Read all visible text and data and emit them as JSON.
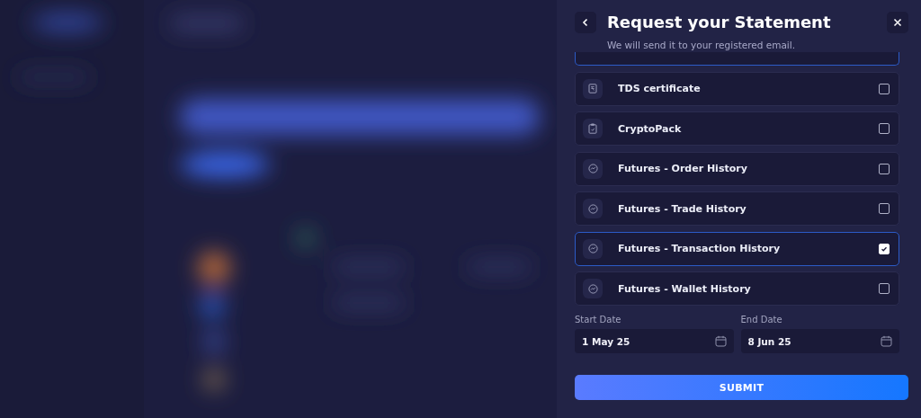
{
  "drawer": {
    "title": "Request your Statement",
    "subtitle": "We will send it to your registered email.",
    "partial_item": {
      "selected": true
    },
    "items": [
      {
        "kind": "document",
        "label": "TDS certificate",
        "checked": false,
        "selected": false
      },
      {
        "kind": "clipboard",
        "label": "CryptoPack",
        "checked": false,
        "selected": false
      },
      {
        "kind": "futures",
        "label": "Futures - Order History",
        "checked": false,
        "selected": false
      },
      {
        "kind": "futures",
        "label": "Futures - Trade History",
        "checked": false,
        "selected": false
      },
      {
        "kind": "futures",
        "label": "Futures - Transaction History",
        "checked": true,
        "selected": true
      },
      {
        "kind": "futures",
        "label": "Futures - Wallet History",
        "checked": false,
        "selected": false
      }
    ],
    "start_date": {
      "label": "Start Date",
      "value": "1 May 25"
    },
    "end_date": {
      "label": "End Date",
      "value": "8 Jun 25"
    },
    "submit": "SUBMIT"
  }
}
